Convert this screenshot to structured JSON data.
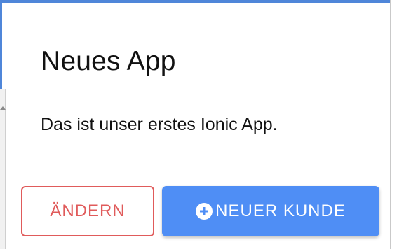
{
  "card": {
    "title": "Neues App",
    "description": "Das ist unser erstes Ionic App."
  },
  "buttons": {
    "edit_label": "ÄNDERN",
    "new_customer_label": "NEUER KUNDE",
    "new_customer_icon": "add-circle-icon"
  },
  "colors": {
    "frame_border": "#4f86d9",
    "edit_button_accent": "#e05b5b",
    "primary_button_bg": "#4f8ef5",
    "text": "#111111"
  }
}
